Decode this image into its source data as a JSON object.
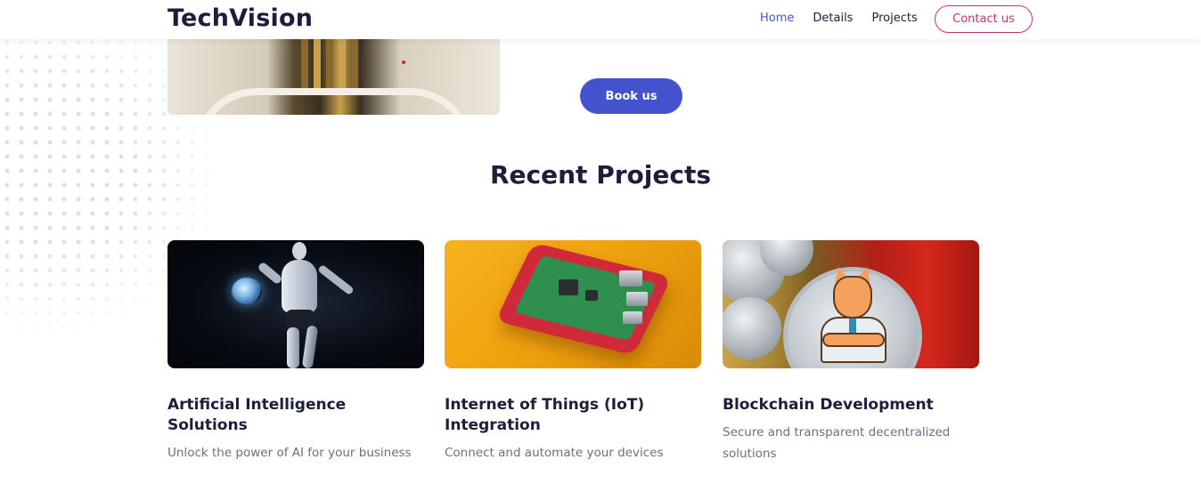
{
  "header": {
    "logo": "TechVision",
    "nav": [
      {
        "label": "Home",
        "active": true
      },
      {
        "label": "Details",
        "active": false
      },
      {
        "label": "Projects",
        "active": false
      }
    ],
    "contact_label": "Contact us"
  },
  "hero": {
    "book_label": "Book us"
  },
  "projects": {
    "title": "Recent Projects",
    "cards": [
      {
        "title": "Artificial Intelligence Solutions",
        "description": "Unlock the power of AI for your business"
      },
      {
        "title": "Internet of Things (IoT) Integration",
        "description": "Connect and automate your devices"
      },
      {
        "title": "Blockchain Development",
        "description": "Secure and transparent decentralized solutions"
      }
    ]
  },
  "colors": {
    "accent": "#4452ce",
    "contact": "#c8327a",
    "heading": "#1b1f3b",
    "muted": "#6b6f80"
  }
}
